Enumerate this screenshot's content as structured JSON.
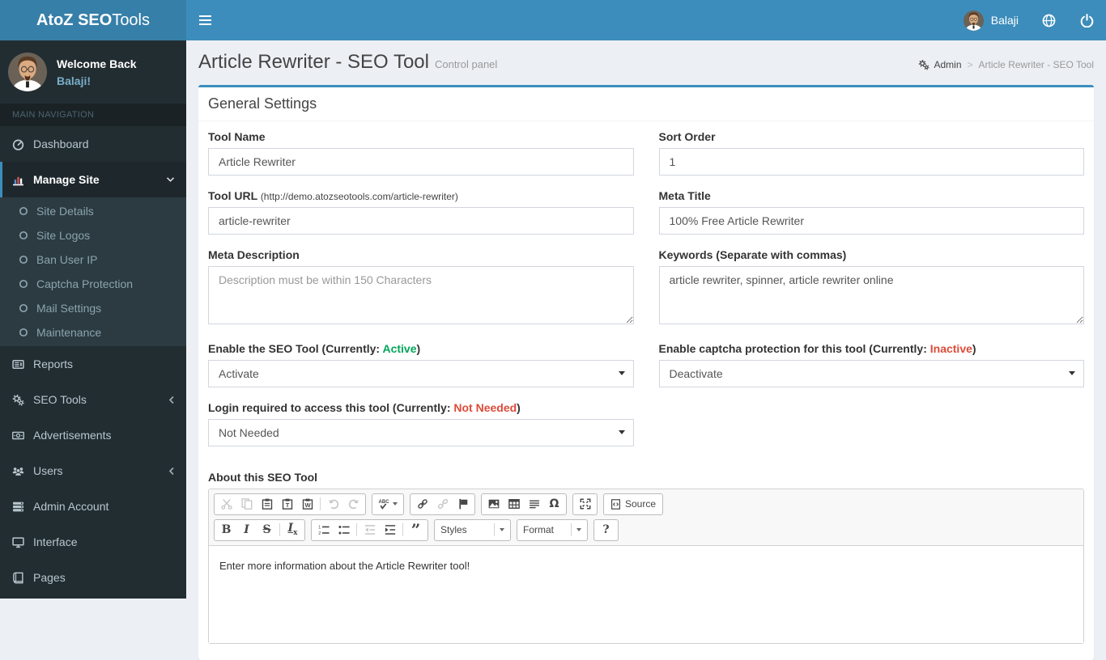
{
  "navbar": {
    "logo_bold": "AtoZ SEO",
    "logo_rest": "Tools",
    "user_name": "Balaji"
  },
  "sidebar": {
    "welcome_title": "Welcome Back",
    "user_name": "Balaji!",
    "section_header": "MAIN NAVIGATION",
    "items": [
      {
        "label": "Dashboard",
        "icon": "gauge-icon"
      },
      {
        "label": "Manage Site",
        "icon": "bar-chart-icon",
        "state": "active-expanded"
      },
      {
        "label": "Reports",
        "icon": "newspaper-icon"
      },
      {
        "label": "SEO Tools",
        "icon": "gears-icon",
        "state": "collapsible"
      },
      {
        "label": "Advertisements",
        "icon": "money-icon"
      },
      {
        "label": "Users",
        "icon": "users-icon",
        "state": "collapsible"
      },
      {
        "label": "Admin Account",
        "icon": "server-icon"
      },
      {
        "label": "Interface",
        "icon": "desktop-icon"
      },
      {
        "label": "Pages",
        "icon": "book-icon"
      }
    ],
    "manage_site_children": [
      "Site Details",
      "Site Logos",
      "Ban User IP",
      "Captcha Protection",
      "Mail Settings",
      "Maintenance"
    ]
  },
  "page_header": {
    "title": "Article Rewriter - SEO Tool",
    "subtitle": "Control panel",
    "breadcrumb": {
      "root": "Admin",
      "separator": ">",
      "current": "Article Rewriter - SEO Tool"
    }
  },
  "panel": {
    "title": "General Settings"
  },
  "form": {
    "tool_name": {
      "label": "Tool Name",
      "value": "Article Rewriter"
    },
    "sort_order": {
      "label": "Sort Order",
      "value": "1"
    },
    "tool_url": {
      "label": "Tool URL",
      "hint": "(http://demo.atozseotools.com/article-rewriter)",
      "value": "article-rewriter"
    },
    "meta_title": {
      "label": "Meta Title",
      "value": "100% Free Article Rewriter"
    },
    "meta_description": {
      "label": "Meta Description",
      "placeholder": "Description must be within 150 Characters",
      "value": ""
    },
    "keywords": {
      "label": "Keywords (Separate with commas)",
      "value": "article rewriter, spinner, article rewriter online"
    },
    "enable_tool": {
      "label_prefix": "Enable the SEO Tool (Currently: ",
      "status": "Active",
      "label_suffix": ")",
      "selected": "Activate"
    },
    "captcha": {
      "label_prefix": "Enable captcha protection for this tool (Currently: ",
      "status": "Inactive",
      "label_suffix": ")",
      "selected": "Deactivate"
    },
    "login": {
      "label_prefix": "Login required to access this tool (Currently: ",
      "status": "Not Needed",
      "label_suffix": ")",
      "selected": "Not Needed"
    },
    "about": {
      "label": "About this SEO Tool",
      "content": "Enter more information about the Article Rewriter tool!"
    }
  },
  "editor": {
    "buttons": {
      "spell": "ABC",
      "source": "Source",
      "styles": "Styles",
      "format": "Format",
      "help": "?",
      "bold": "B",
      "italic": "I",
      "strike": "S",
      "removeformat_main": "I",
      "removeformat_sub": "x",
      "omega": "Ω",
      "quote": "”"
    }
  },
  "colors": {
    "navbar": "#3c8dbc",
    "logo_bg": "#367fa9",
    "sidebar_bg": "#222d32",
    "submenu_bg": "#2c3b41",
    "active_item_bg": "#1e282c",
    "content_bg": "#ecf0f5",
    "status_active": "#00a65a",
    "status_inactive": "#dd4b39",
    "sidebar_text": "#b8c7ce"
  }
}
